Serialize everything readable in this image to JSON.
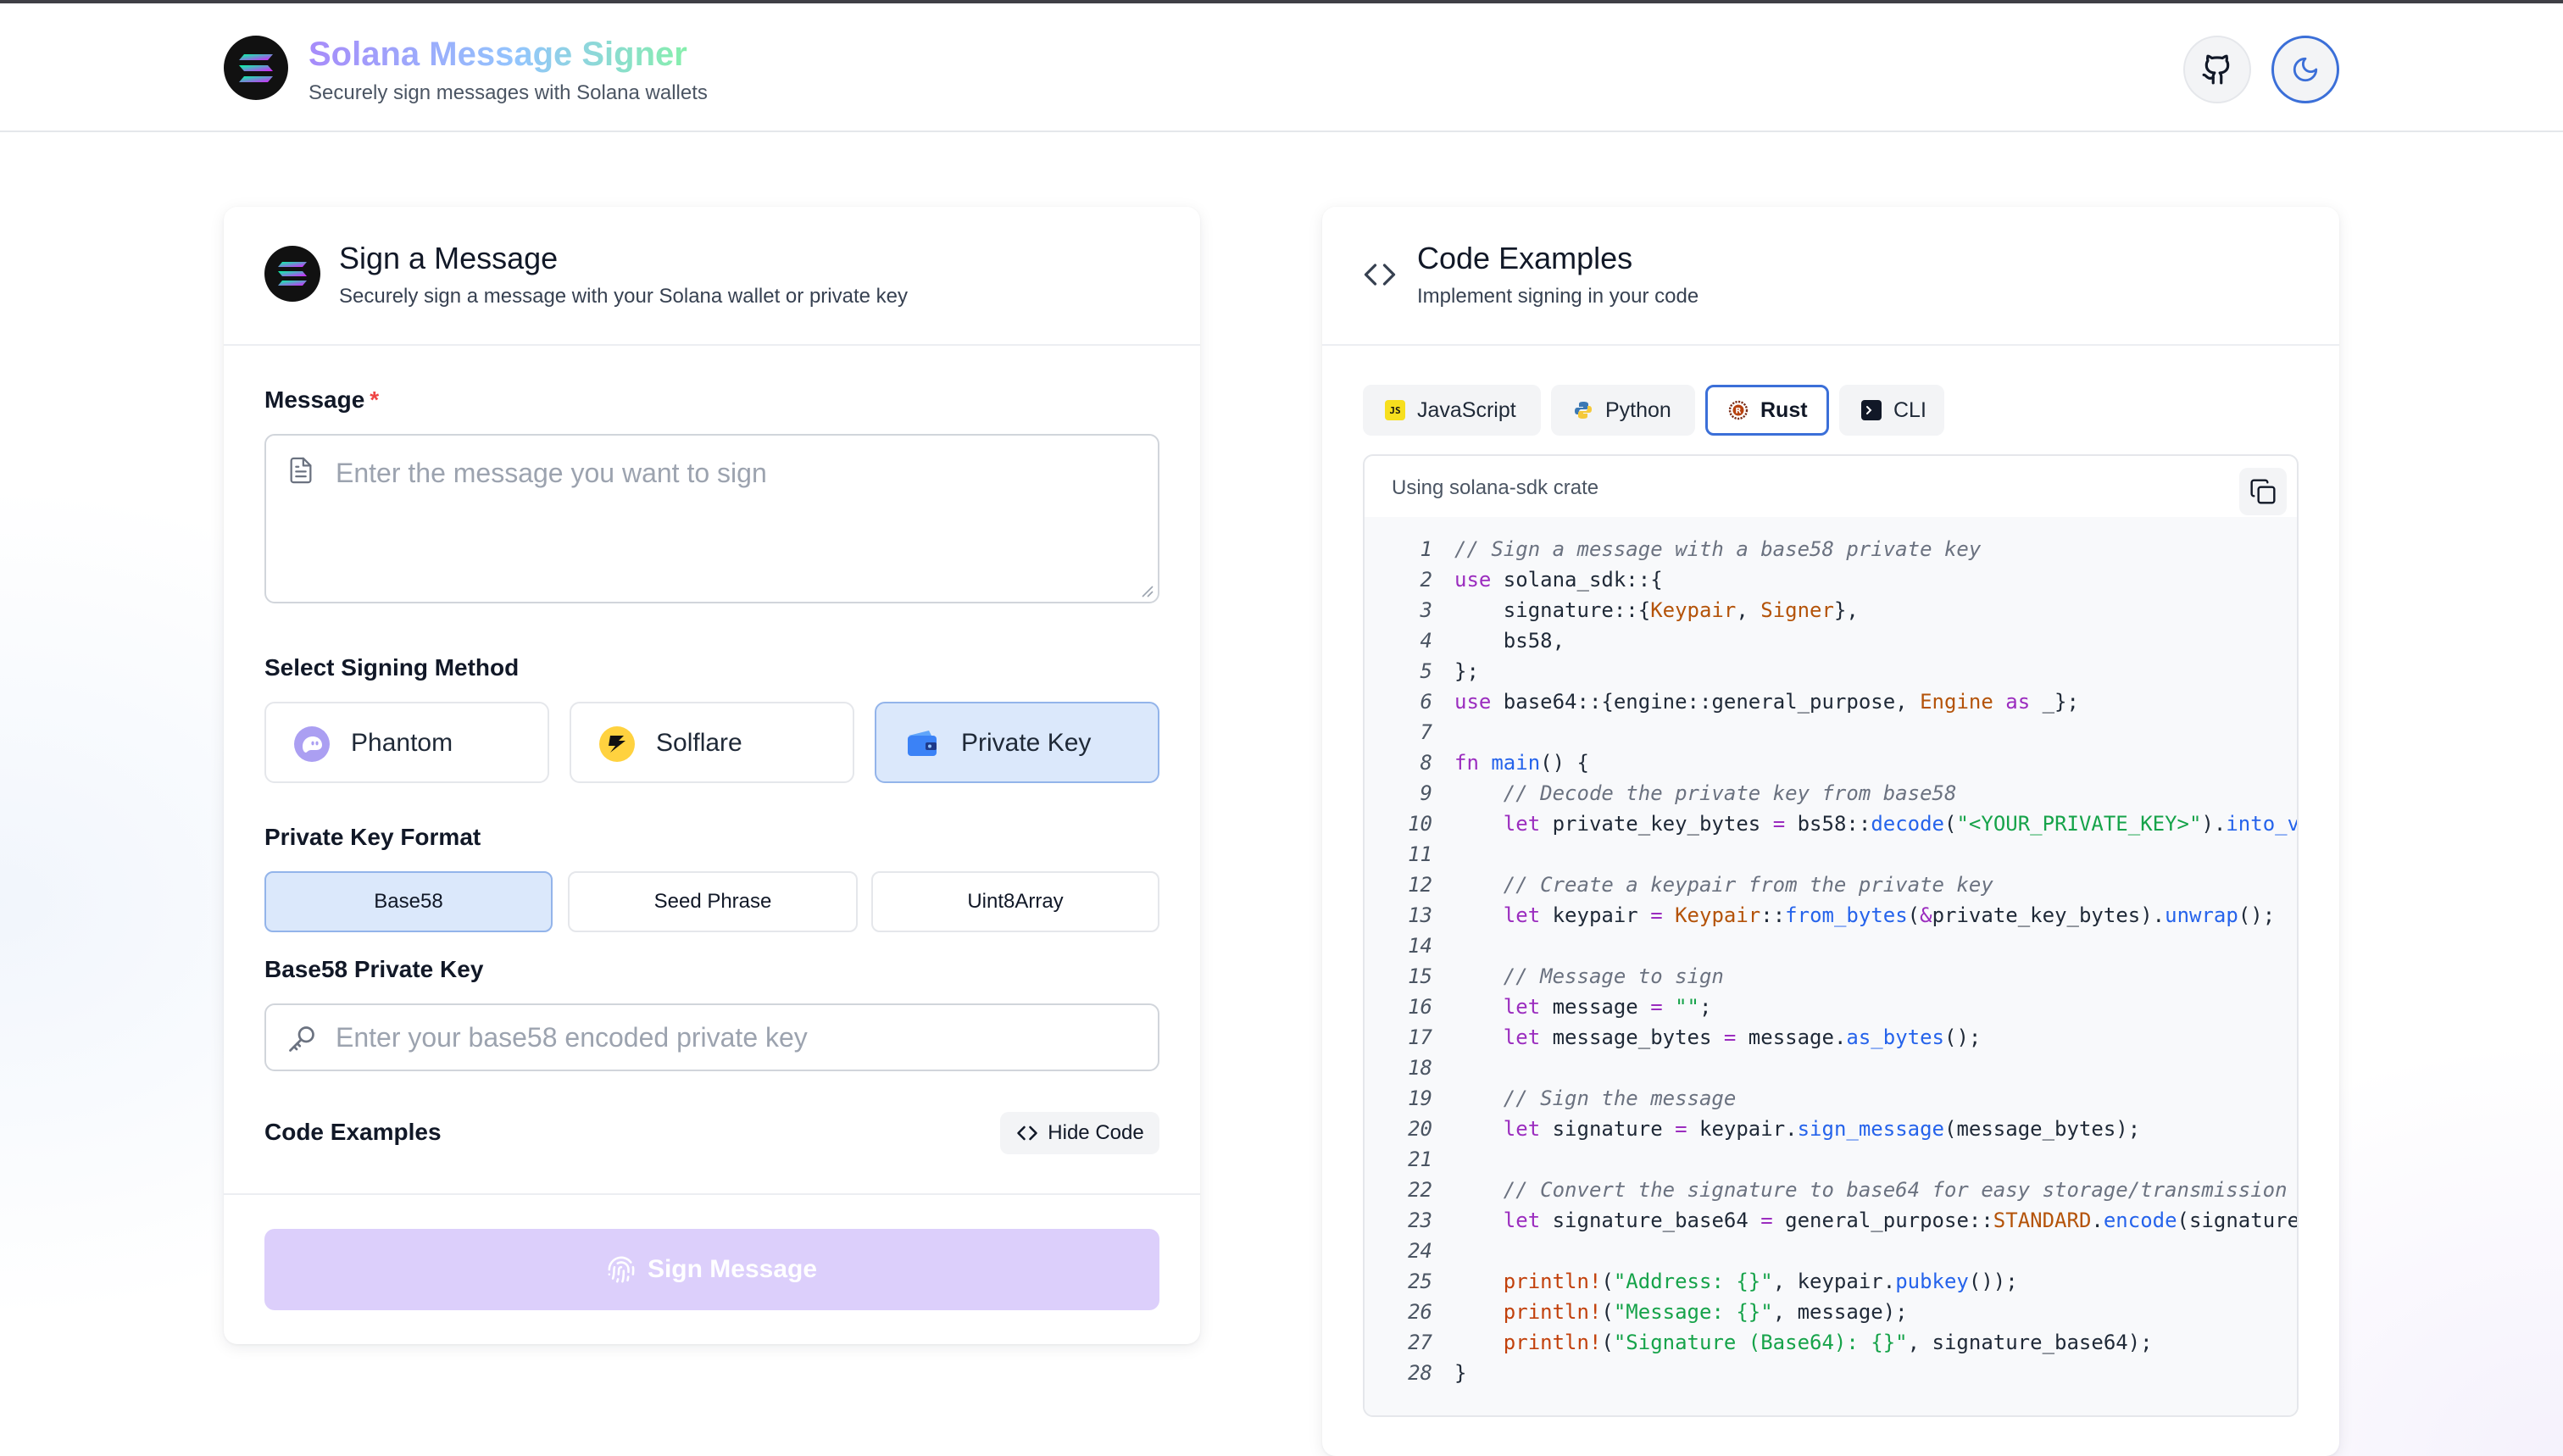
{
  "app": {
    "title": "Solana Message Signer",
    "subtitle": "Securely sign messages with Solana wallets"
  },
  "header": {
    "github_icon": "github-icon",
    "theme_icon": "moon-icon"
  },
  "sign_card": {
    "title": "Sign a Message",
    "subtitle": "Securely sign a message with your Solana wallet or private key",
    "message_label": "Message",
    "required_mark": "*",
    "message_placeholder": "Enter the message you want to sign",
    "method_label": "Select Signing Method",
    "methods": [
      {
        "label": "Phantom",
        "icon": "phantom-icon",
        "active": false
      },
      {
        "label": "Solflare",
        "icon": "solflare-icon",
        "active": false
      },
      {
        "label": "Private Key",
        "icon": "wallet-icon",
        "active": true
      }
    ],
    "format_label": "Private Key Format",
    "formats": [
      {
        "label": "Base58",
        "active": true
      },
      {
        "label": "Seed Phrase",
        "active": false
      },
      {
        "label": "Uint8Array",
        "active": false
      }
    ],
    "key_label": "Base58 Private Key",
    "key_placeholder": "Enter your base58 encoded private key",
    "code_examples_label": "Code Examples",
    "hide_code_label": "Hide Code",
    "sign_button_label": "Sign Message",
    "sign_button_disabled": true
  },
  "code_card": {
    "title": "Code Examples",
    "subtitle": "Implement signing in your code",
    "tabs": [
      {
        "label": "JavaScript",
        "icon": "js-icon",
        "active": false
      },
      {
        "label": "Python",
        "icon": "python-icon",
        "active": false
      },
      {
        "label": "Rust",
        "icon": "rust-icon",
        "active": true
      },
      {
        "label": "CLI",
        "icon": "terminal-icon",
        "active": false
      }
    ],
    "caption": "Using solana-sdk crate",
    "copy_icon": "copy-icon",
    "code_lines": [
      "// Sign a message with a base58 private key",
      "use solana_sdk::{",
      "    signature::{Keypair, Signer},",
      "    bs58,",
      "};",
      "use base64::{engine::general_purpose, Engine as _};",
      "",
      "fn main() {",
      "    // Decode the private key from base58",
      "    let private_key_bytes = bs58::decode(\"<YOUR_PRIVATE_KEY>\").into_v",
      "",
      "    // Create a keypair from the private key",
      "    let keypair = Keypair::from_bytes(&private_key_bytes).unwrap();",
      "",
      "    // Message to sign",
      "    let message = \"\";",
      "    let message_bytes = message.as_bytes();",
      "",
      "    // Sign the message",
      "    let signature = keypair.sign_message(message_bytes);",
      "",
      "    // Convert the signature to base64 for easy storage/transmission",
      "    let signature_base64 = general_purpose::STANDARD.encode(signature",
      "",
      "    println!(\"Address: {}\", keypair.pubkey());",
      "    println!(\"Message: {}\", message);",
      "    println!(\"Signature (Base64): {}\", signature_base64);",
      "}"
    ]
  },
  "colors": {
    "accent": "#3b6fd8",
    "active_fill": "#dbe8fb",
    "sign_button": "#dccffb",
    "required": "#ef4444"
  }
}
